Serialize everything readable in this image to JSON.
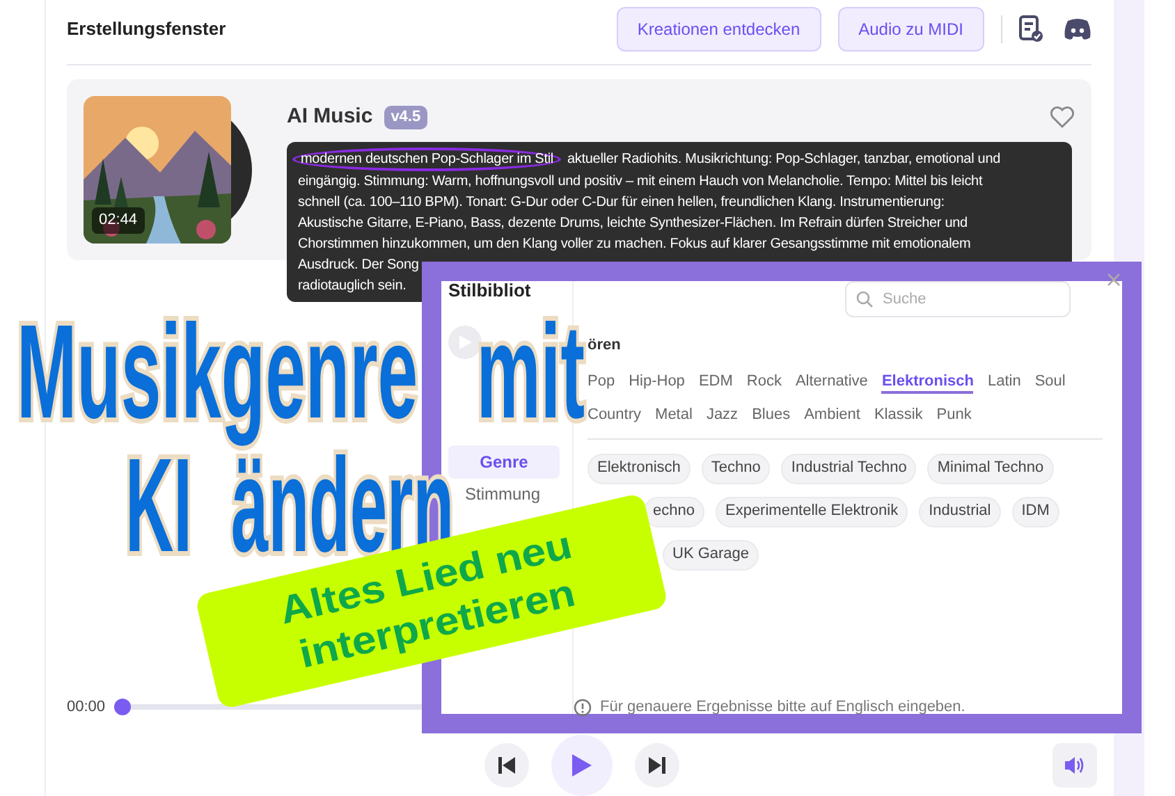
{
  "header": {
    "title": "Erstellungsfenster",
    "buttons": [
      "Kreationen entdecken",
      "Audio zu MIDI"
    ]
  },
  "track": {
    "title": "AI Music",
    "version": "v4.5",
    "duration": "02:44",
    "prompt_highlight": "modernen deutschen Pop-Schlager im Stil",
    "prompt_lines": [
      "aktueller Radiohits. Musikrichtung: Pop-Schlager, tanzbar, emotional und",
      "eingängig. Stimmung: Warm, hoffnungsvoll und positiv – mit einem Hauch von Melancholie. Tempo: Mittel bis leicht",
      "schnell (ca. 100–110 BPM). Tonart: G-Dur oder C-Dur für einen hellen, freundlichen Klang. Instrumentierung:",
      "Akustische Gitarre, E-Piano, Bass, dezente Drums, leichte Synthesizer-Flächen. Im Refrain dürfen Streicher und",
      "Chorstimmen hinzukommen, um den Klang voller zu machen. Fokus auf klarer Gesangsstimme mit emotionalem",
      "Ausdruck. Der Song",
      "radiotauglich sein."
    ]
  },
  "player": {
    "time": "00:00",
    "level": 0
  },
  "modal": {
    "title": "Stilbibliot",
    "search_placeholder": "Suche",
    "section_label": "ören",
    "sidebar": [
      {
        "label": "Genre",
        "selected": true
      },
      {
        "label": "Stimmung",
        "selected": false
      }
    ],
    "genres": [
      {
        "label": "Pop",
        "selected": false
      },
      {
        "label": "Hip-Hop",
        "selected": false
      },
      {
        "label": "EDM",
        "selected": false
      },
      {
        "label": "Rock",
        "selected": false
      },
      {
        "label": "Alternative",
        "selected": false
      },
      {
        "label": "Elektronisch",
        "selected": true
      },
      {
        "label": "Latin",
        "selected": false
      },
      {
        "label": "Soul",
        "selected": false
      },
      {
        "label": "Country",
        "selected": false
      },
      {
        "label": "Metal",
        "selected": false
      },
      {
        "label": "Jazz",
        "selected": false
      },
      {
        "label": "Blues",
        "selected": false
      },
      {
        "label": "Ambient",
        "selected": false
      },
      {
        "label": "Klassik",
        "selected": false
      },
      {
        "label": "Punk",
        "selected": false
      }
    ],
    "chip_rows": [
      [
        "Elektronisch",
        "Techno",
        "Industrial Techno",
        "Minimal Techno"
      ],
      [
        "echno",
        "Experimentelle Elektronik",
        "Industrial",
        "IDM"
      ],
      [
        "UK Garage"
      ]
    ],
    "hint": "Für genauere Ergebnisse bitte auf Englisch eingeben."
  },
  "headline": [
    [
      "Musikgenre",
      "mit"
    ],
    [
      "KI",
      "ändern"
    ]
  ],
  "banner": [
    "Altes Lied neu",
    "interpretieren"
  ]
}
